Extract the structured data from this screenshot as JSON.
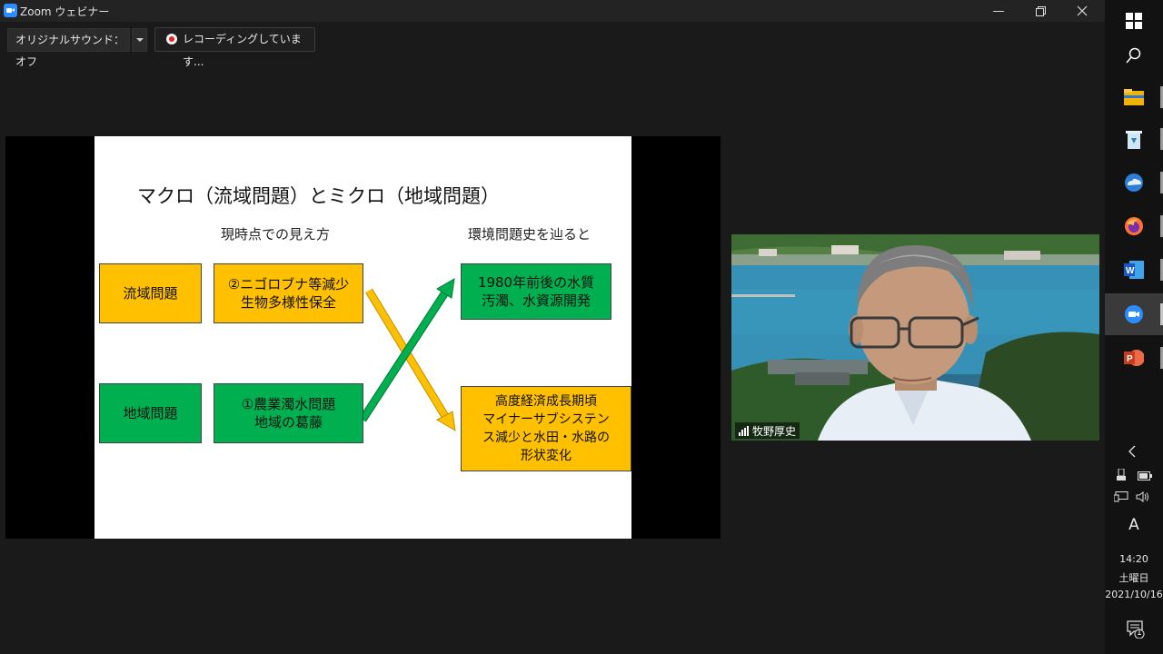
{
  "window": {
    "title": "Zoom ウェビナー"
  },
  "toolbar": {
    "sound_label": "オリジナルサウンド：オフ",
    "recording_label": "レコーディングしています..."
  },
  "slide": {
    "title": "マクロ（流域問題）とミクロ（地域問題）",
    "col_current": "現時点での見え方",
    "col_history": "環境問題史を辿ると",
    "row1_label": "流域問題",
    "row2_label": "地域問題",
    "box_upper_mid": "②ニゴロブナ等減少\n生物多様性保全",
    "box_lower_mid": "①農業濁水問題\n地域の葛藤",
    "box_upper_right": "1980年前後の水質\n汚濁、水資源開発",
    "box_lower_right": "高度経済成長期頃\nマイナーサブシステン\nス減少と水田・水路の\n形状変化",
    "colors": {
      "orange": "#ffc000",
      "green": "#00b050"
    }
  },
  "video": {
    "participant_name": "牧野厚史"
  },
  "taskbar": {
    "icons": [
      "windows-start-icon",
      "search-icon",
      "file-explorer-icon",
      "recycle-bin-icon",
      "onedrive-icon",
      "firefox-icon",
      "word-icon",
      "zoom-icon",
      "powerpoint-icon"
    ],
    "time": "14:20",
    "weekday": "土曜日",
    "date": "2021/10/16",
    "ime_indicator": "A",
    "notification_count": "1"
  }
}
